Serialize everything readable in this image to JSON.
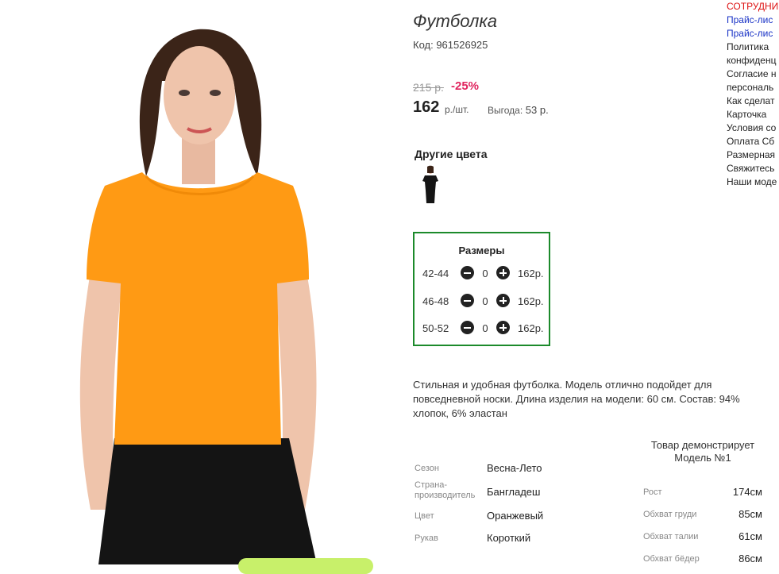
{
  "product": {
    "title": "Футболка",
    "sku": "Код: 961526925",
    "old_price": "215 р.",
    "discount": "-25%",
    "price": "162",
    "price_unit": "р./шт.",
    "savings_label": "Выгода:",
    "savings_value": "53 р."
  },
  "colors": {
    "title": "Другие цвета"
  },
  "sizes": {
    "title": "Размеры",
    "rows": [
      {
        "size": "42-44",
        "qty": "0",
        "price": "162р."
      },
      {
        "size": "46-48",
        "qty": "0",
        "price": "162р."
      },
      {
        "size": "50-52",
        "qty": "0",
        "price": "162р."
      }
    ]
  },
  "description": "Стильная и удобная футболка. Модель отлично подойдет для повседневной носки. Длина изделия на модели: 60 см. Состав: 94% хлопок, 6% эластан",
  "specs": [
    {
      "label": "Сезон",
      "value": "Весна-Лето"
    },
    {
      "label": "Страна-производитель",
      "value": "Бангладеш"
    },
    {
      "label": "Цвет",
      "value": "Оранжевый"
    },
    {
      "label": "Рукав",
      "value": "Короткий"
    }
  ],
  "model": {
    "title": "Товар демонстрирует Модель №1",
    "measurements": [
      {
        "label": "Рост",
        "value": "174см"
      },
      {
        "label": "Обхват груди",
        "value": "85см"
      },
      {
        "label": "Обхват талии",
        "value": "61см"
      },
      {
        "label": "Обхват бёдер",
        "value": "86см"
      }
    ]
  },
  "side_links": [
    {
      "text": "СОТРУДНИ",
      "style": "red"
    },
    {
      "text": "Прайс-лис",
      "style": "blue"
    },
    {
      "text": "Прайс-лис",
      "style": "blue"
    },
    {
      "text": "Политика",
      "style": "plain"
    },
    {
      "text": "конфиденц",
      "style": "plain"
    },
    {
      "text": "Согласие н",
      "style": "plain"
    },
    {
      "text": "персональ",
      "style": "plain"
    },
    {
      "text": "Как сделат",
      "style": "plain"
    },
    {
      "text": "Карточка",
      "style": "plain"
    },
    {
      "text": "Условия со",
      "style": "plain"
    },
    {
      "text": "Оплата Сб",
      "style": "plain"
    },
    {
      "text": "Размерная",
      "style": "plain"
    },
    {
      "text": "Свяжитесь",
      "style": "plain"
    },
    {
      "text": "Наши моде",
      "style": "plain"
    }
  ],
  "colors_palette": {
    "sizes_border": "#1c8a2b",
    "discount": "#e0245e",
    "shirt": "#ff9a14",
    "link_blue": "#1a33c6",
    "link_red": "#dd1111"
  }
}
